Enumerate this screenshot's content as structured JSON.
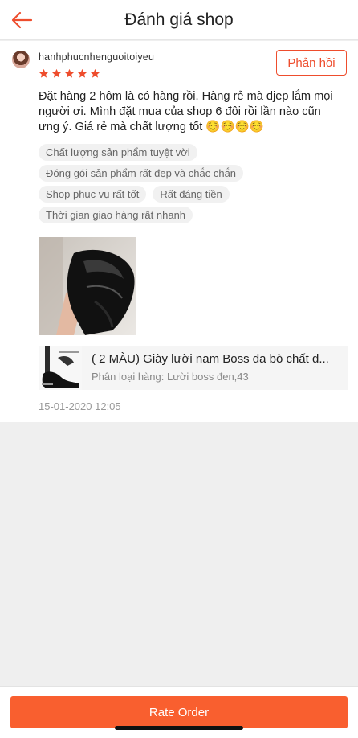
{
  "header": {
    "title": "Đánh giá shop",
    "back_icon": "arrow-left-icon",
    "accent_color": "#ee4d2d"
  },
  "review": {
    "username": "hanhphucnhenguoitoiyeu",
    "rating": 5,
    "reply_label": "Phản hồi",
    "text": "Đặt hàng 2 hôm là có hàng rồi. Hàng rẻ mà đjep lắm mọi người ơi. Mình đặt mua của shop 6 đôi rồi lần nào cũn ưng ý. Giá rẻ mà chất lượng tốt ☺️☺️☺️☺️",
    "tags": [
      "Chất lượng sản phẩm tuyệt vời",
      "Đóng gói sản phẩm rất đẹp và chắc chắn",
      "Shop phục vụ rất tốt",
      "Rất đáng tiền",
      "Thời gian giao hàng rất nhanh"
    ],
    "product": {
      "name": "( 2 MÀU) Giày lười nam Boss da bò chất đ...",
      "variant": "Phân loại hàng: Lười boss đen,43"
    },
    "date": "15-01-2020 12:05"
  },
  "footer": {
    "rate_label": "Rate Order",
    "button_color": "#f95f2f"
  }
}
